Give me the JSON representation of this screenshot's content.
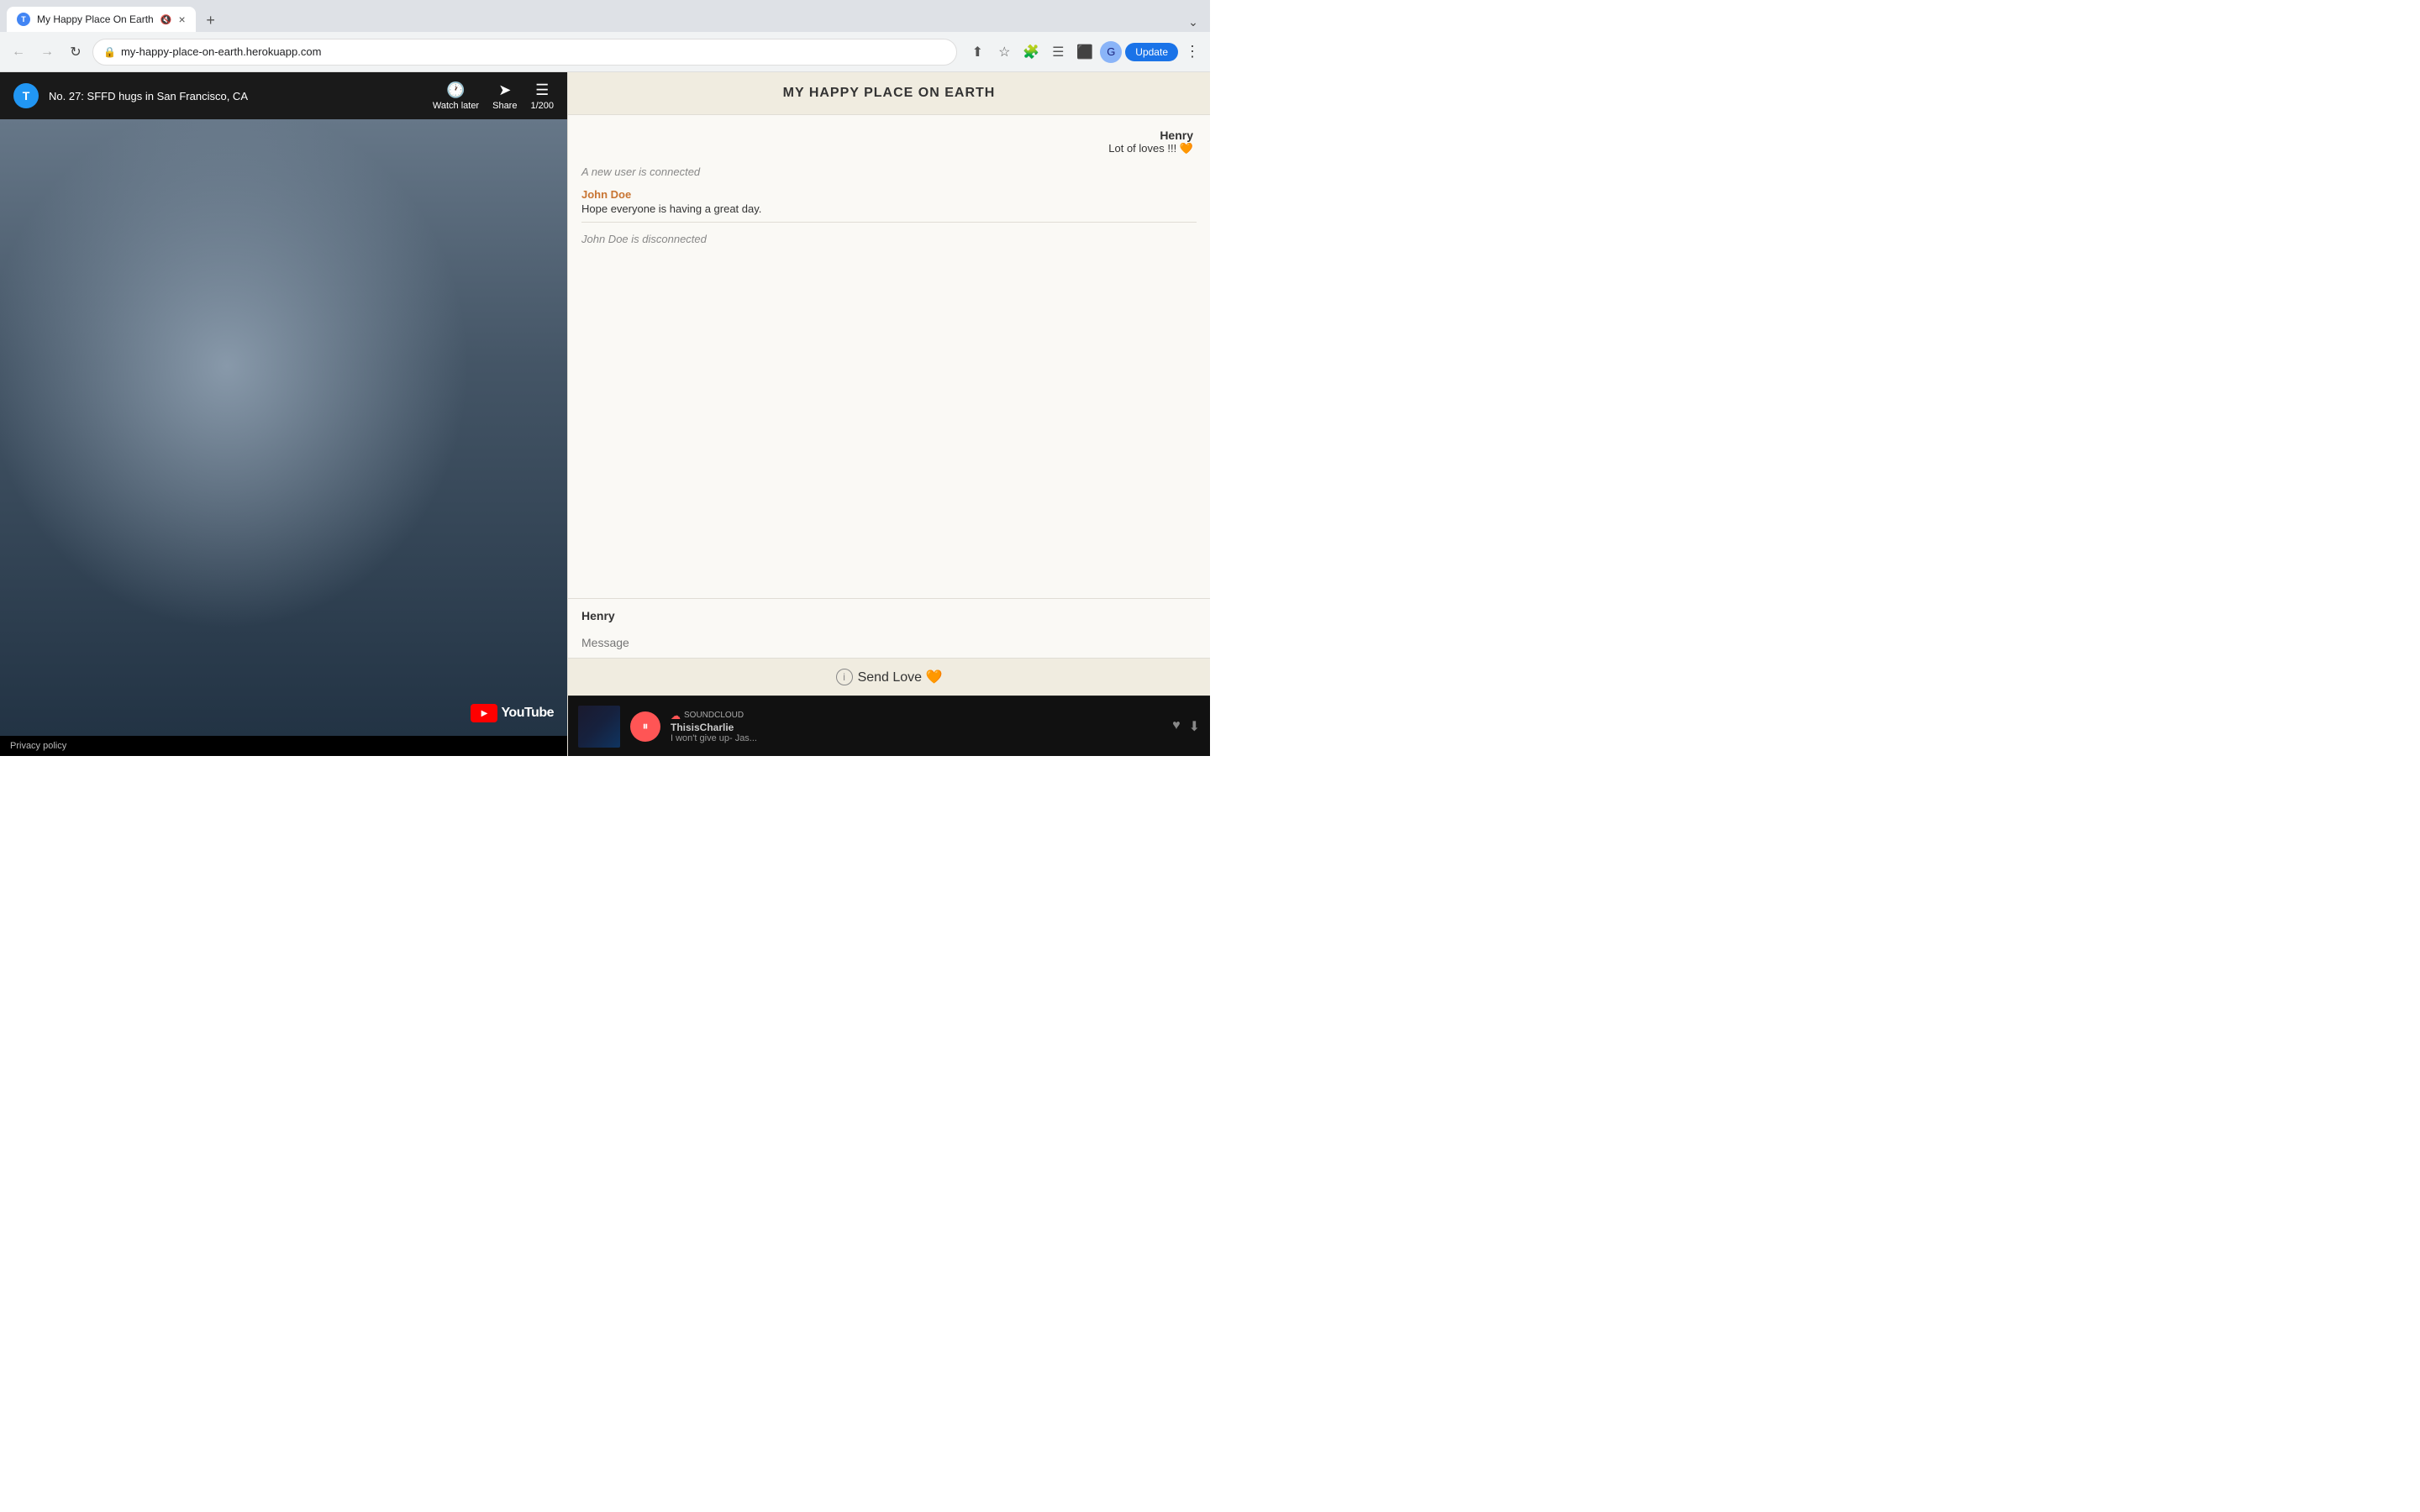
{
  "browser": {
    "tab": {
      "favicon_letter": "T",
      "title": "My Happy Place On Earth",
      "mute_icon": "🔇",
      "close_icon": "×",
      "new_tab_icon": "+"
    },
    "address_bar": {
      "url": "my-happy-place-on-earth.herokuapp.com",
      "lock_icon": "🔒"
    },
    "toolbar": {
      "share_icon": "⬆",
      "bookmark_icon": "☆",
      "extensions_icon": "🧩",
      "queue_icon": "☰",
      "sidebar_icon": "⬛",
      "update_label": "Update",
      "menu_icon": "⋮"
    }
  },
  "video": {
    "channel_letter": "T",
    "title": "No. 27: SFFD hugs in San Francisco, CA",
    "watch_later_label": "Watch later",
    "share_label": "Share",
    "queue_label": "1/200",
    "youtube_label": "YouTube",
    "privacy_label": "Privacy policy"
  },
  "chat": {
    "header_title": "MY HAPPY PLACE ON EARTH",
    "messages": [
      {
        "type": "henry_msg",
        "name": "Henry",
        "text": "Lot of loves !!! 🧡"
      },
      {
        "type": "system",
        "text": "A new user is connected"
      },
      {
        "type": "user_msg",
        "name": "John Doe",
        "text": "Hope everyone is having a great day."
      },
      {
        "type": "system_disconnected",
        "text": "John Doe is disconnected"
      }
    ],
    "current_user": "Henry",
    "message_placeholder": "Message",
    "send_love_label": "Send Love 🧡",
    "info_icon": "i"
  },
  "soundcloud": {
    "logo_text": "SOUNDCLOUD",
    "artist": "ThisisCharlie",
    "track": "I won't give up- Jas...",
    "play_icon": "⏸",
    "love_icon": "♥",
    "download_icon": "⬇"
  }
}
